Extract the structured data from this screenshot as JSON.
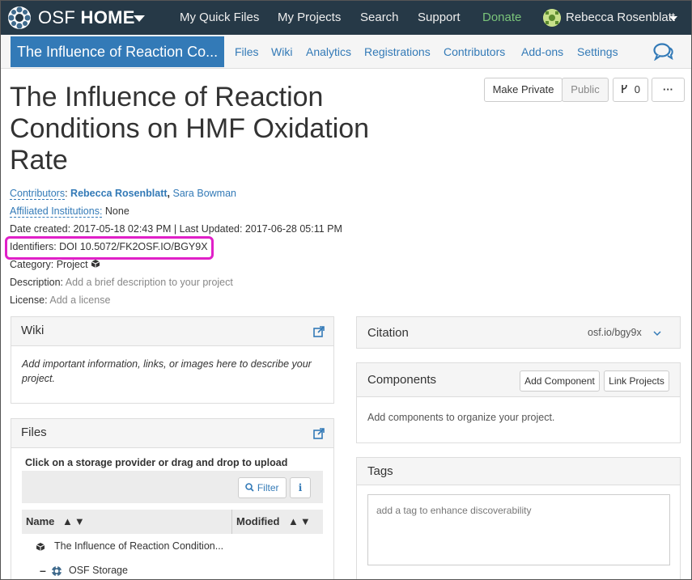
{
  "topnav": {
    "brand_light": "OSF",
    "brand_bold": "HOME",
    "links": [
      "My Quick Files",
      "My Projects",
      "Search",
      "Support",
      "Donate"
    ],
    "user_name": "Rebecca Rosenblatt"
  },
  "projnav": {
    "title": "The Influence of Reaction Co...",
    "links": [
      "Files",
      "Wiki",
      "Analytics",
      "Registrations",
      "Contributors",
      "Add-ons",
      "Settings"
    ]
  },
  "header": {
    "title": "The Influence of Reaction Conditions on HMF Oxidation Rate",
    "make_private": "Make Private",
    "public": "Public",
    "fork_count": "0",
    "more": "···"
  },
  "meta": {
    "contributors_label": "Contributors",
    "contributor_1": "Rebecca Rosenblatt",
    "contributor_2": "Sara Bowman",
    "affiliated_label": "Affiliated Institutions:",
    "affiliated_value": "None",
    "dates": "Date created: 2017-05-18 02:43 PM | Last Updated: 2017-06-28 05:11 PM",
    "identifiers": "Identifiers: DOI 10.5072/FK2OSF.IO/BGY9X",
    "category_label": "Category:",
    "category_value": "Project",
    "description_label": "Description:",
    "description_value": "Add a brief description to your project",
    "license_label": "License:",
    "license_value": "Add a license"
  },
  "wiki": {
    "title": "Wiki",
    "body": "Add important information, links, or images here to describe your project."
  },
  "files": {
    "title": "Files",
    "instruction": "Click on a storage provider or drag and drop to upload",
    "filter": "Filter",
    "col_name": "Name",
    "col_modified": "Modified",
    "row_project": "The Influence of Reaction Condition...",
    "row_storage": "OSF Storage"
  },
  "citation": {
    "title": "Citation",
    "link": "osf.io/bgy9x"
  },
  "components": {
    "title": "Components",
    "add_button": "Add Component",
    "link_button": "Link Projects",
    "body": "Add components to organize your project."
  },
  "tags": {
    "title": "Tags",
    "placeholder": "add a tag to enhance discoverability"
  },
  "colors": {
    "topnav": "#263947",
    "primary": "#337ab7",
    "highlight": "#e020c8",
    "donate": "#7ac47a"
  }
}
